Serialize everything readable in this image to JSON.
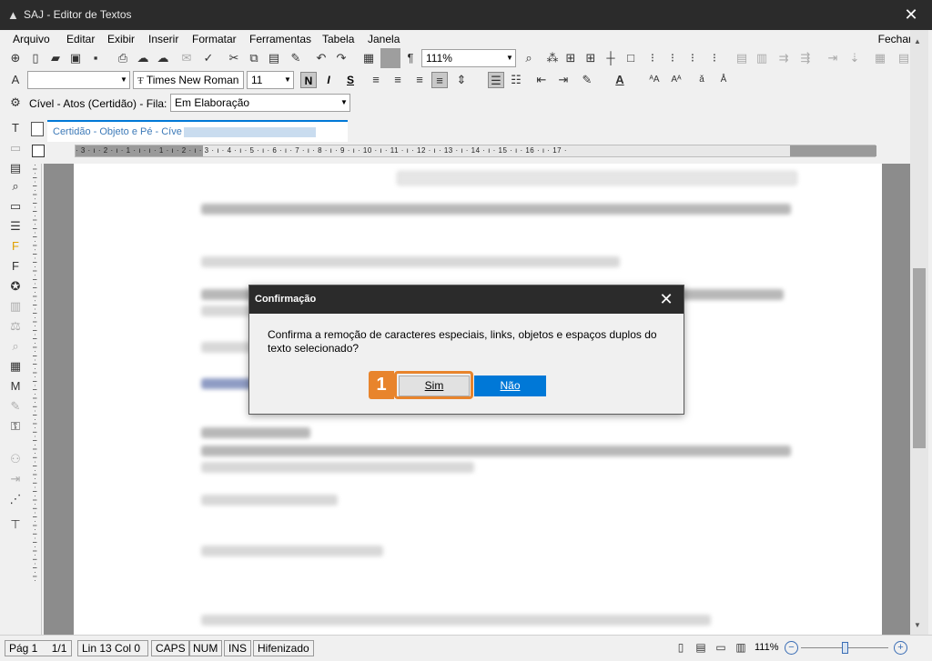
{
  "window": {
    "title": "SAJ - Editor de Textos"
  },
  "menu": {
    "items": [
      "Arquivo",
      "Editar",
      "Exibir",
      "Inserir",
      "Formatar",
      "Ferramentas",
      "Tabela",
      "Janela"
    ],
    "fechar": "Fechar"
  },
  "toolbar": {
    "zoom": "111%",
    "style": "",
    "font": "Times New Roman",
    "font_size": "11",
    "bold": "N",
    "italic": "I",
    "underline": "S",
    "pilcrow": "¶"
  },
  "fila": {
    "label": "Cível - Atos (Certidão) - Fila:",
    "value": "Em Elaboração"
  },
  "document_tab": {
    "label": "Certidão - Objeto e Pé - Cíve"
  },
  "ruler": {
    "ticks": "· 3 · ı · 2 · ı · 1 · ı · ı · 1 · ı · 2 · ı · 3 · ı · 4 · ı · 5 · ı · 6 · ı · 7 · ı · 8 · ı · 9 · ı · 10 · ı · 11 · ı · 12 · ı · 13 · ı · 14 · ı · 15 · ı · 16 · ı · 17 ·"
  },
  "dialog": {
    "title": "Confirmação",
    "message": "Confirma a remoção de caracteres especiais, links, objetos e espaços duplos do texto selecionado?",
    "yes": "Sim",
    "no": "Não"
  },
  "annotation": {
    "step": "1"
  },
  "status": {
    "page": "Pág 1",
    "pages": "1/1",
    "position": "Lin 13  Col 0",
    "caps": "CAPS",
    "num": "NUM",
    "ins": "INS",
    "hyphen": "Hifenizado",
    "zoom": "111%"
  }
}
